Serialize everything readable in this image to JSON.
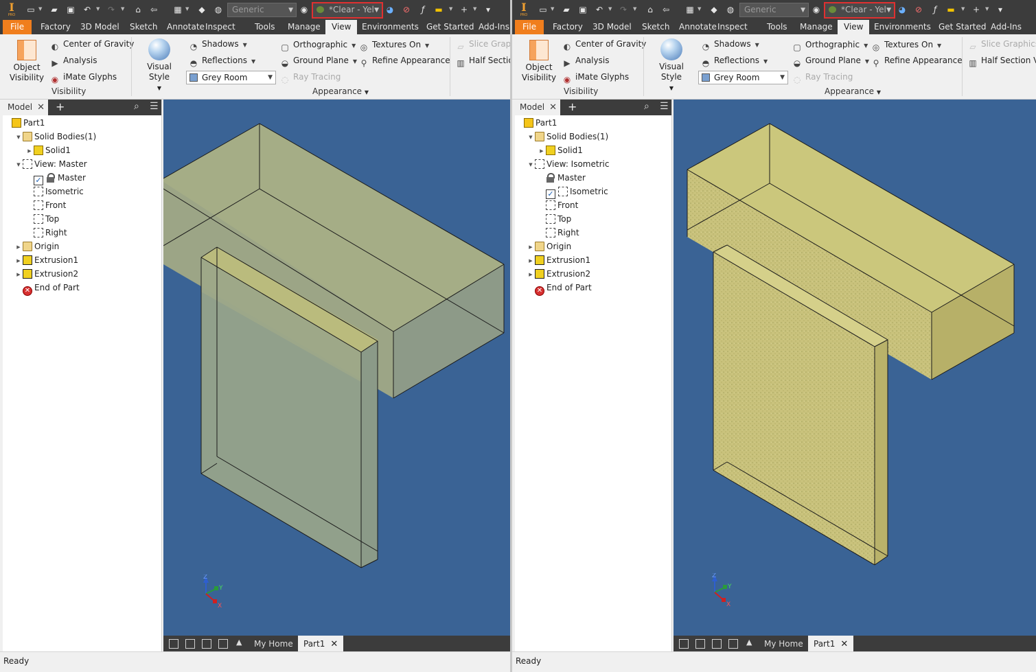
{
  "panes": [
    {
      "id": "paneA",
      "qat": {
        "style_combo": "Generic",
        "material_combo": "*Clear - Yel"
      },
      "tabs": [
        "File",
        "Factory",
        "3D Model",
        "Sketch",
        "Annotate",
        "Inspect",
        "Tools",
        "Manage",
        "View",
        "Environments",
        "Get Started",
        "Add-Ins"
      ],
      "active_tab": "View",
      "ribbon": {
        "object_visibility": "Object\nVisibility",
        "center_of_gravity": "Center of Gravity",
        "analysis": "Analysis",
        "imate_glyphs": "iMate Glyphs",
        "visibility_label": "Visibility",
        "visual_style": "Visual Style",
        "shadows": "Shadows",
        "reflections": "Reflections",
        "grey_room": "Grey Room",
        "orthographic": "Orthographic",
        "ground_plane": "Ground Plane",
        "ray_tracing": "Ray Tracing",
        "textures_on": "Textures On",
        "refine_appearance": "Refine Appearance",
        "appearance_label": "Appearance",
        "slice_graphics": "Slice Graph",
        "half_section": "Half Sectio"
      },
      "browser": {
        "tab": "Model",
        "nodes": [
          {
            "label": "Part1",
            "indent": 0,
            "icon": "part",
            "twisty": ""
          },
          {
            "label": "Solid Bodies(1)",
            "indent": 1,
            "icon": "folder",
            "twisty": "▼"
          },
          {
            "label": "Solid1",
            "indent": 2,
            "icon": "solid",
            "twisty": "▶"
          },
          {
            "label": "View: Master",
            "indent": 1,
            "icon": "view",
            "twisty": "▼"
          },
          {
            "label": "Master",
            "indent": 2,
            "icon": "lock",
            "twisty": "",
            "checked": true
          },
          {
            "label": "Isometric",
            "indent": 2,
            "icon": "view",
            "twisty": ""
          },
          {
            "label": "Front",
            "indent": 2,
            "icon": "view",
            "twisty": ""
          },
          {
            "label": "Top",
            "indent": 2,
            "icon": "view",
            "twisty": ""
          },
          {
            "label": "Right",
            "indent": 2,
            "icon": "view",
            "twisty": ""
          },
          {
            "label": "Origin",
            "indent": 1,
            "icon": "folder",
            "twisty": "▶"
          },
          {
            "label": "Extrusion1",
            "indent": 1,
            "icon": "extr",
            "twisty": "▶"
          },
          {
            "label": "Extrusion2",
            "indent": 1,
            "icon": "extr",
            "twisty": "▶"
          },
          {
            "label": "End of Part",
            "indent": 1,
            "icon": "endpart",
            "twisty": ""
          }
        ]
      },
      "triad": {
        "z": "Z",
        "y": "Y",
        "x": "X"
      },
      "docbar": {
        "home": "My Home",
        "part_tab": "Part1"
      },
      "status": "Ready",
      "render_mode": "clear"
    },
    {
      "id": "paneB",
      "qat": {
        "style_combo": "Generic",
        "material_combo": "*Clear - Yel"
      },
      "tabs": [
        "File",
        "Factory",
        "3D Model",
        "Sketch",
        "Annotate",
        "Inspect",
        "Tools",
        "Manage",
        "View",
        "Environments",
        "Get Started",
        "Add-Ins"
      ],
      "active_tab": "View",
      "ribbon": {
        "object_visibility": "Object\nVisibility",
        "center_of_gravity": "Center of Gravity",
        "analysis": "Analysis",
        "imate_glyphs": "iMate Glyphs",
        "visibility_label": "Visibility",
        "visual_style": "Visual Style",
        "shadows": "Shadows",
        "reflections": "Reflections",
        "grey_room": "Grey Room",
        "orthographic": "Orthographic",
        "ground_plane": "Ground Plane",
        "ray_tracing": "Ray Tracing",
        "textures_on": "Textures On",
        "refine_appearance": "Refine Appearance",
        "appearance_label": "Appearance",
        "slice_graphics": "Slice Graphics",
        "half_section": "Half Section Vie"
      },
      "browser": {
        "tab": "Model",
        "nodes": [
          {
            "label": "Part1",
            "indent": 0,
            "icon": "part",
            "twisty": ""
          },
          {
            "label": "Solid Bodies(1)",
            "indent": 1,
            "icon": "folder",
            "twisty": "▼"
          },
          {
            "label": "Solid1",
            "indent": 2,
            "icon": "solid",
            "twisty": "▶"
          },
          {
            "label": "View: Isometric",
            "indent": 1,
            "icon": "view",
            "twisty": "▼"
          },
          {
            "label": "Master",
            "indent": 2,
            "icon": "lock",
            "twisty": ""
          },
          {
            "label": "Isometric",
            "indent": 2,
            "icon": "view",
            "twisty": "",
            "checked": true
          },
          {
            "label": "Front",
            "indent": 2,
            "icon": "view",
            "twisty": ""
          },
          {
            "label": "Top",
            "indent": 2,
            "icon": "view",
            "twisty": ""
          },
          {
            "label": "Right",
            "indent": 2,
            "icon": "view",
            "twisty": ""
          },
          {
            "label": "Origin",
            "indent": 1,
            "icon": "folder",
            "twisty": "▶"
          },
          {
            "label": "Extrusion1",
            "indent": 1,
            "icon": "extr",
            "twisty": "▶"
          },
          {
            "label": "Extrusion2",
            "indent": 1,
            "icon": "extr",
            "twisty": "▶"
          },
          {
            "label": "End of Part",
            "indent": 1,
            "icon": "endpart",
            "twisty": ""
          }
        ]
      },
      "triad": {
        "z": "Z",
        "y": "Y",
        "x": "X"
      },
      "docbar": {
        "home": "My Home",
        "part_tab": "Part1"
      },
      "status": "Ready",
      "render_mode": "textured"
    }
  ],
  "colors": {
    "file_tab": "#f07e1d",
    "dark_chrome": "#3c3c3c",
    "viewport_bg": "#3a6395",
    "highlight_border": "#e03030",
    "clear_body": "#a5ad86",
    "textured_body": "#c8c37a"
  },
  "icons": {
    "qat": [
      "new-icon",
      "open-icon",
      "save-icon",
      "undo-icon",
      "redo-icon",
      "home-icon",
      "return-icon",
      "select-icon",
      "appearance-icon",
      "material-sphere-icon",
      "adjust-icon",
      "clear-icon",
      "fx-icon",
      "color-bar-icon",
      "crosshair-icon",
      "more-icon"
    ]
  }
}
